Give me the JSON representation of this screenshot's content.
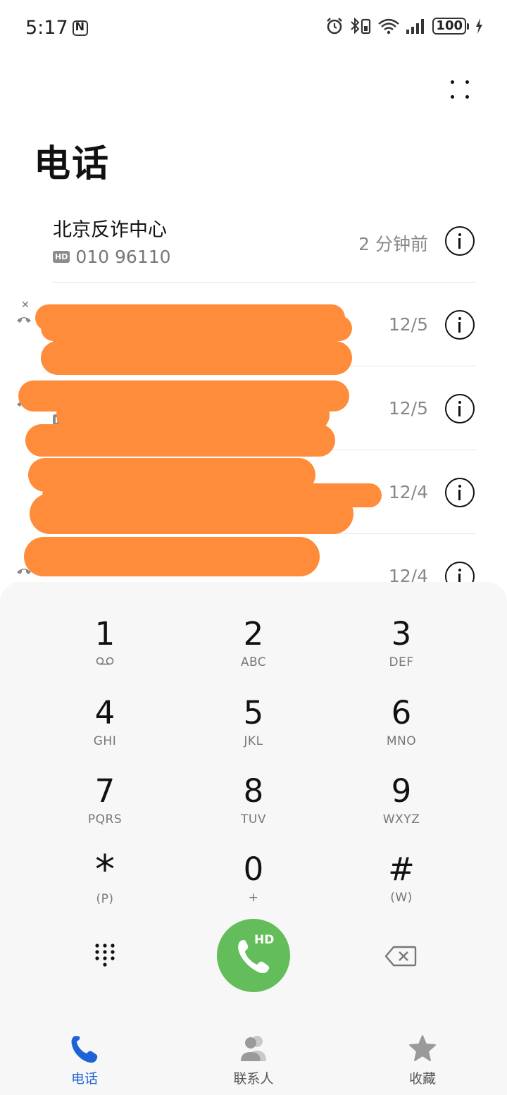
{
  "status_bar": {
    "time": "5:17",
    "battery": "100"
  },
  "header": {
    "title": "电话"
  },
  "call_log": [
    {
      "name": "北京反诈中心",
      "badge": "HD",
      "number": "010 96110",
      "time": "2 分钟前"
    },
    {
      "name": "",
      "badge": "HD",
      "number": "",
      "time": "12/5"
    },
    {
      "name": "",
      "badge": "HD",
      "number": "",
      "time": "12/5"
    },
    {
      "name": "",
      "badge": "",
      "number": "",
      "time": "12/4"
    },
    {
      "name": "",
      "badge": "",
      "number": "",
      "time": "12/4"
    }
  ],
  "dialpad": {
    "keys": [
      {
        "digit": "1",
        "letters": ""
      },
      {
        "digit": "2",
        "letters": "ABC"
      },
      {
        "digit": "3",
        "letters": "DEF"
      },
      {
        "digit": "4",
        "letters": "GHI"
      },
      {
        "digit": "5",
        "letters": "JKL"
      },
      {
        "digit": "6",
        "letters": "MNO"
      },
      {
        "digit": "7",
        "letters": "PQRS"
      },
      {
        "digit": "8",
        "letters": "TUV"
      },
      {
        "digit": "9",
        "letters": "WXYZ"
      },
      {
        "digit": "*",
        "letters": "(P)"
      },
      {
        "digit": "0",
        "letters": "+"
      },
      {
        "digit": "#",
        "letters": "(W)"
      }
    ],
    "call_badge": "HD",
    "call_color": "#62bd5a"
  },
  "bottom_nav": {
    "items": [
      {
        "label": "电话",
        "icon": "phone-icon",
        "active": true
      },
      {
        "label": "联系人",
        "icon": "contacts-icon",
        "active": false
      },
      {
        "label": "收藏",
        "icon": "star-icon",
        "active": false
      }
    ],
    "active_color": "#1e63d6"
  }
}
